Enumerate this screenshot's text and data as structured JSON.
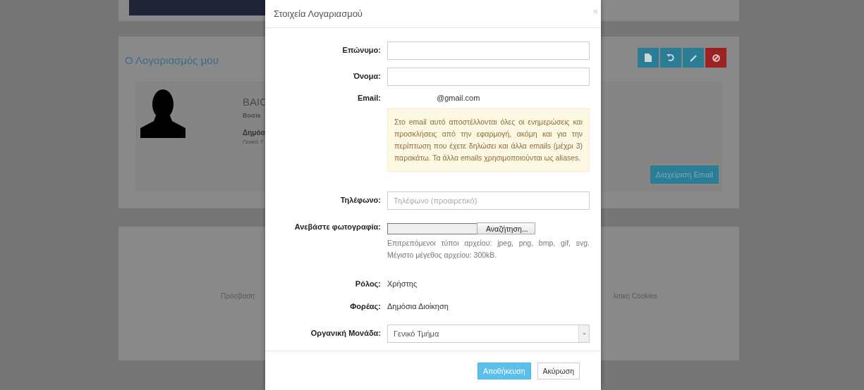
{
  "background_page": {
    "account_panel": {
      "title": "Ο Λογαριασμός μου",
      "toolbar_buttons": [
        {
          "kind": "document",
          "color": "#2b7c95"
        },
        {
          "kind": "undo",
          "color": "#2b7c95"
        },
        {
          "kind": "pencil",
          "color": "#2b7c95"
        },
        {
          "kind": "ban",
          "color": "#9a2222"
        }
      ],
      "profile": {
        "name": "BAIC",
        "role": "Βοσικ",
        "organization": "Δημόσ",
        "unit": "Γενικό Τ"
      },
      "manage_email_button": "Διαχείριση Email"
    },
    "footer_links": [
      "Πρόσβαση",
      "λιτική Cookies"
    ]
  },
  "dialog": {
    "title": "Στοιχεία Λογαριασμού",
    "close": "×",
    "fields": [
      {
        "kind": "input",
        "label": "Επώνυμο:"
      },
      {
        "kind": "input",
        "label": "Όνομα:"
      },
      {
        "kind": "static",
        "label": "Email:",
        "value": "@gmail.com",
        "note": "Στο email αυτό αποστέλλονται όλες οι ενημερώσεις και προσκλήσεις από την εφαρμογή, ακόμη και για την περίπτωση που έχετε δηλώσει και άλλα emails (μέχρι 3) παρακάτω. Τα άλλα emails χρησιμοποιούνται ως aliases."
      },
      {
        "kind": "input",
        "label": "Τηλέφωνο:",
        "placeholder": "Τηλέφωνο (προαιρετικό)"
      },
      {
        "kind": "file",
        "label": "Ανεβάστε φωτογραφία:",
        "button": "Αναζήτηση...",
        "help": "Επιτρεπόμενοι τύποι αρχείου: jpeg, png, bmp, gif, svg. Μέγιστο μέγεθος αρχείου: 300kB."
      },
      {
        "kind": "static",
        "label": "Ρόλος:",
        "value": "Χρήστης"
      },
      {
        "kind": "static",
        "label": "Φορέας:",
        "value": "Δημόσια Διοίκηση"
      },
      {
        "kind": "select",
        "label": "Οργανική Μονάδα:",
        "value": "Γενικό Τμήμα"
      }
    ],
    "buttons": [
      {
        "kind": "primary",
        "label": "Αποθήκευση"
      },
      {
        "kind": "default",
        "label": "Ακύρωση"
      }
    ]
  }
}
